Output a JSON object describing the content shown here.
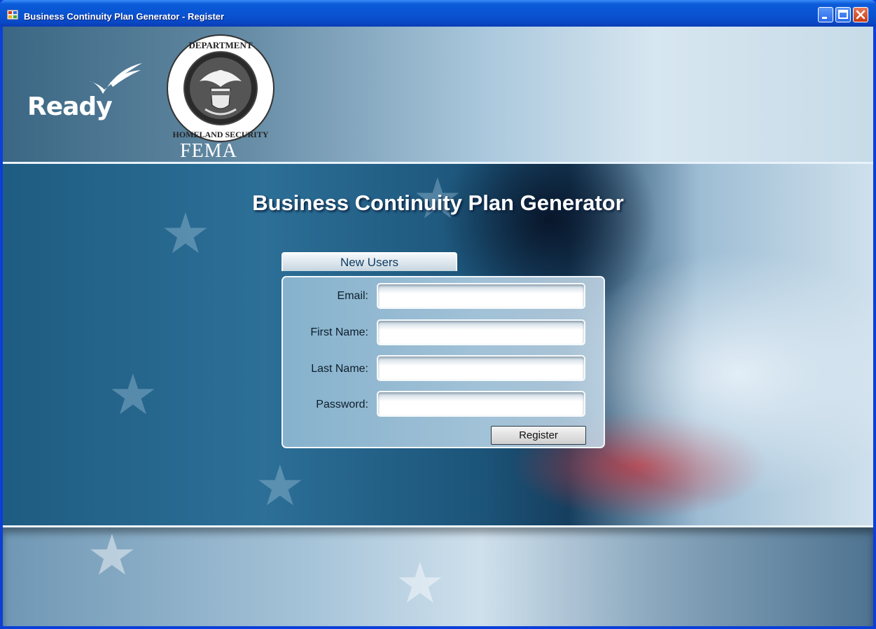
{
  "window": {
    "title": "Business Continuity Plan Generator - Register",
    "controls": [
      "minimize-icon",
      "maximize-icon",
      "close-icon"
    ]
  },
  "header": {
    "ready_logo_text": "Ready",
    "seal_text": "U.S. DEPARTMENT OF HOMELAND SECURITY",
    "agency": "FEMA"
  },
  "main": {
    "title": "Business Continuity Plan Generator",
    "form": {
      "tab_label": "New Users",
      "fields": [
        {
          "label": "Email:",
          "value": ""
        },
        {
          "label": "First Name:",
          "value": ""
        },
        {
          "label": "Last Name:",
          "value": ""
        },
        {
          "label": "Password:",
          "value": ""
        }
      ],
      "submit_label": "Register"
    }
  },
  "colors": {
    "titlebar": "#0a52d0",
    "close_button": "#c83a12",
    "title_text": "#ffffff",
    "tab_text": "#123c63"
  }
}
